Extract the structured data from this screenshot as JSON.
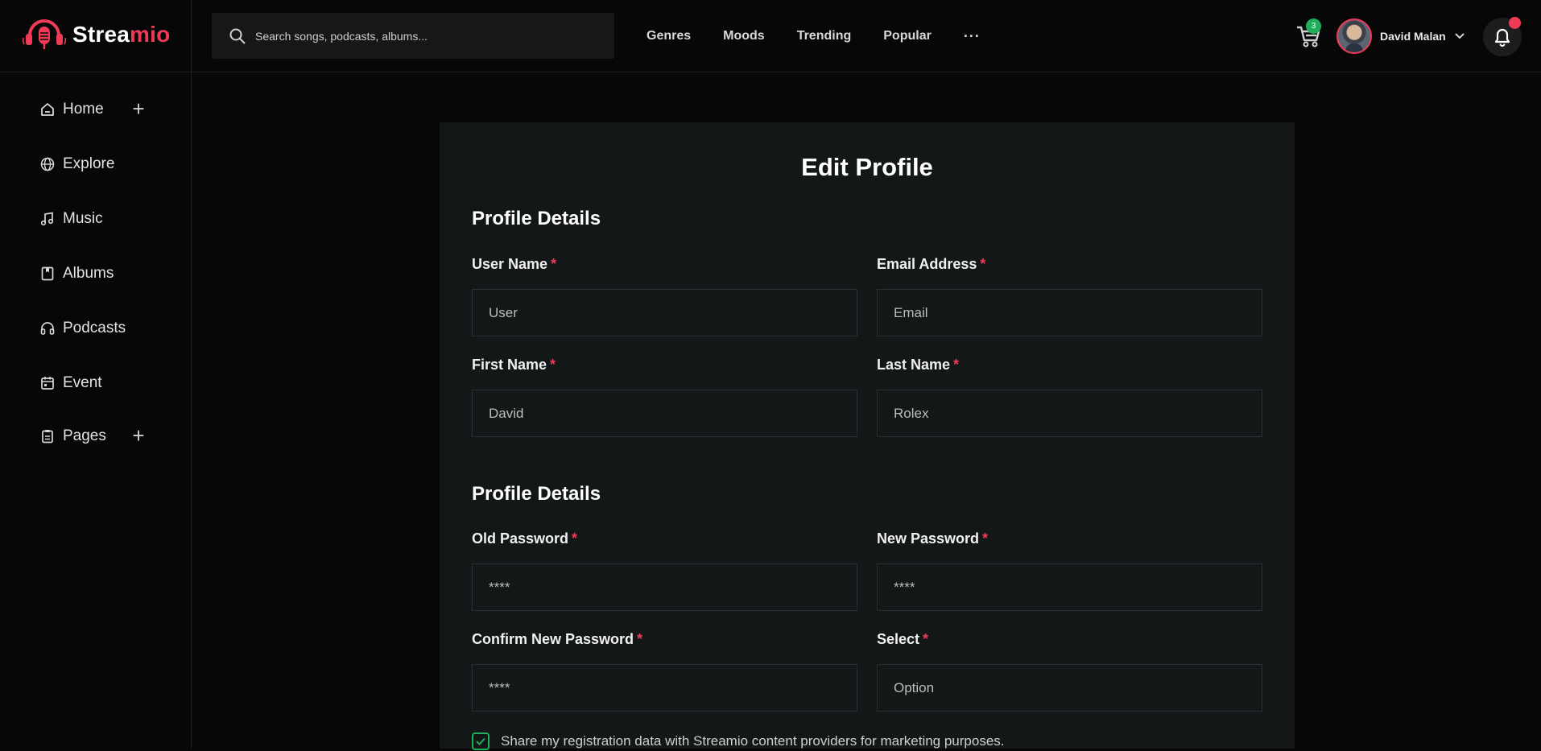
{
  "brand": {
    "name_main": "Strea",
    "name_accent": "mio",
    "accent_color": "#ef3a58"
  },
  "search": {
    "placeholder": "Search songs, podcasts, albums..."
  },
  "topnav": {
    "items": [
      "Genres",
      "Moods",
      "Trending",
      "Popular"
    ],
    "more_label": "···"
  },
  "cart": {
    "badge_count": "3",
    "badge_color": "#1fae5b"
  },
  "user": {
    "name": "David Malan"
  },
  "notifications": {
    "dot_color": "#ef3a58"
  },
  "sidebar": {
    "items": [
      {
        "label": "Home",
        "icon": "home-icon",
        "expandable": true
      },
      {
        "label": "Explore",
        "icon": "globe-icon",
        "expandable": false
      },
      {
        "label": "Music",
        "icon": "music-note-icon",
        "expandable": false
      },
      {
        "label": "Albums",
        "icon": "album-icon",
        "expandable": false
      },
      {
        "label": "Podcasts",
        "icon": "headphones-icon",
        "expandable": false
      },
      {
        "label": "Event",
        "icon": "calendar-icon",
        "expandable": false
      },
      {
        "label": "Pages",
        "icon": "clipboard-icon",
        "expandable": true
      }
    ],
    "expand_symbol": "+"
  },
  "form": {
    "title": "Edit Profile",
    "section1_title": "Profile Details",
    "section2_title": "Profile Details",
    "required_mark": "*",
    "fields": {
      "username": {
        "label": "User Name",
        "placeholder": "User"
      },
      "email": {
        "label": "Email Address",
        "placeholder": "Email"
      },
      "first_name": {
        "label": "First Name",
        "placeholder": "David"
      },
      "last_name": {
        "label": "Last Name",
        "placeholder": "Rolex"
      },
      "old_password": {
        "label": "Old Password",
        "placeholder": "****"
      },
      "new_password": {
        "label": "New Password",
        "placeholder": "****"
      },
      "confirm_password": {
        "label": "Confirm New Password",
        "placeholder": "****"
      },
      "select": {
        "label": "Select",
        "placeholder": "Option"
      }
    },
    "consent": {
      "checked": true,
      "text": "Share my registration data with Streamio content providers for marketing purposes."
    }
  }
}
